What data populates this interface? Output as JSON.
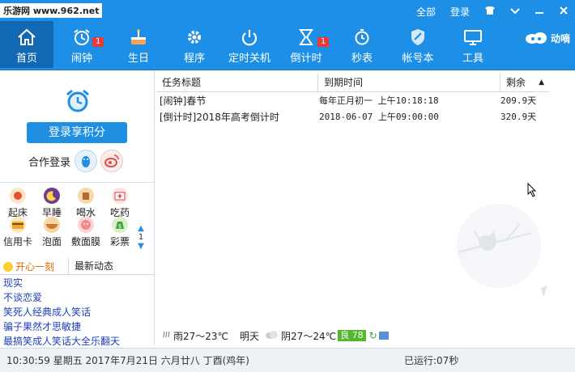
{
  "watermark": "乐游网 www.962.net",
  "top_menu": {
    "all": "全部",
    "login": "登录"
  },
  "nav": [
    {
      "label": "首页",
      "badge": ""
    },
    {
      "label": "闹钟",
      "badge": "1"
    },
    {
      "label": "生日",
      "badge": ""
    },
    {
      "label": "程序",
      "badge": ""
    },
    {
      "label": "定时关机",
      "badge": ""
    },
    {
      "label": "倒计时",
      "badge": "1"
    },
    {
      "label": "秒表",
      "badge": ""
    },
    {
      "label": "帐号本",
      "badge": ""
    },
    {
      "label": "工具",
      "badge": ""
    }
  ],
  "logo_text": "动嘀",
  "sidebar": {
    "login_button": "登录享积分",
    "coop_login": "合作登录",
    "grid": [
      "起床",
      "早睡",
      "喝水",
      "吃药",
      "信用卡",
      "泡面",
      "敷面膜",
      "彩票"
    ],
    "page_indicator": "1",
    "tabs": {
      "fun": "开心一刻",
      "news": "最新动态"
    },
    "jokes": [
      "现实",
      "不谈恋爱",
      "笑死人经典成人笑话",
      "骗子果然才思敏捷",
      "最搞笑成人笑话大全乐翻天"
    ]
  },
  "table": {
    "columns": [
      "任务标题",
      "到期时间",
      "剩余"
    ],
    "rows": [
      {
        "title": "[闹钟]春节",
        "due": "每年正月初一 上午10:18:18",
        "remaining": "209.9天"
      },
      {
        "title": "[倒计时]2018年高考倒计时",
        "due": "2018-06-07 上午09:00:00",
        "remaining": "320.9天"
      }
    ]
  },
  "weather": {
    "today": "雨27～23℃",
    "tomorrow_label": "明天",
    "tomorrow": "阴27～24℃",
    "aqi": "良 78"
  },
  "status": {
    "datetime": "10:30:59 星期五 2017年7月21日 六月廿八 丁酉(鸡年)",
    "running": "已运行:07秒"
  },
  "colors": {
    "header": "#1e8fe6",
    "active_tab": "#1368b4",
    "badge": "#e8393b",
    "link": "#1e3fb8"
  }
}
